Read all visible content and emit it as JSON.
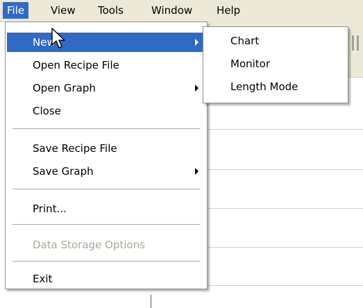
{
  "menubar": {
    "items": [
      {
        "label": "File",
        "active": true
      },
      {
        "label": "View"
      },
      {
        "label": "Tools"
      },
      {
        "label": "Window"
      },
      {
        "label": "Help"
      }
    ]
  },
  "file_menu": {
    "items": [
      {
        "label": "New",
        "submenu": true,
        "highlighted": true
      },
      {
        "label": "Open Recipe File"
      },
      {
        "label": "Open Graph",
        "submenu": true
      },
      {
        "label": "Close"
      },
      {
        "label": "Save Recipe File"
      },
      {
        "label": "Save Graph",
        "submenu": true
      },
      {
        "label": "Print..."
      },
      {
        "label": "Data Storage Options",
        "disabled": true
      },
      {
        "label": "Exit"
      }
    ]
  },
  "new_submenu": {
    "items": [
      {
        "label": "Chart"
      },
      {
        "label": "Monitor"
      },
      {
        "label": "Length Mode"
      }
    ]
  },
  "colors": {
    "highlight": "#316ac5",
    "menubar_bg": "#ece9d8",
    "disabled_text": "#aca899"
  },
  "icons": {
    "cursor": "arrow-pointer-icon",
    "submenu_arrow": "triangle-right-icon"
  }
}
